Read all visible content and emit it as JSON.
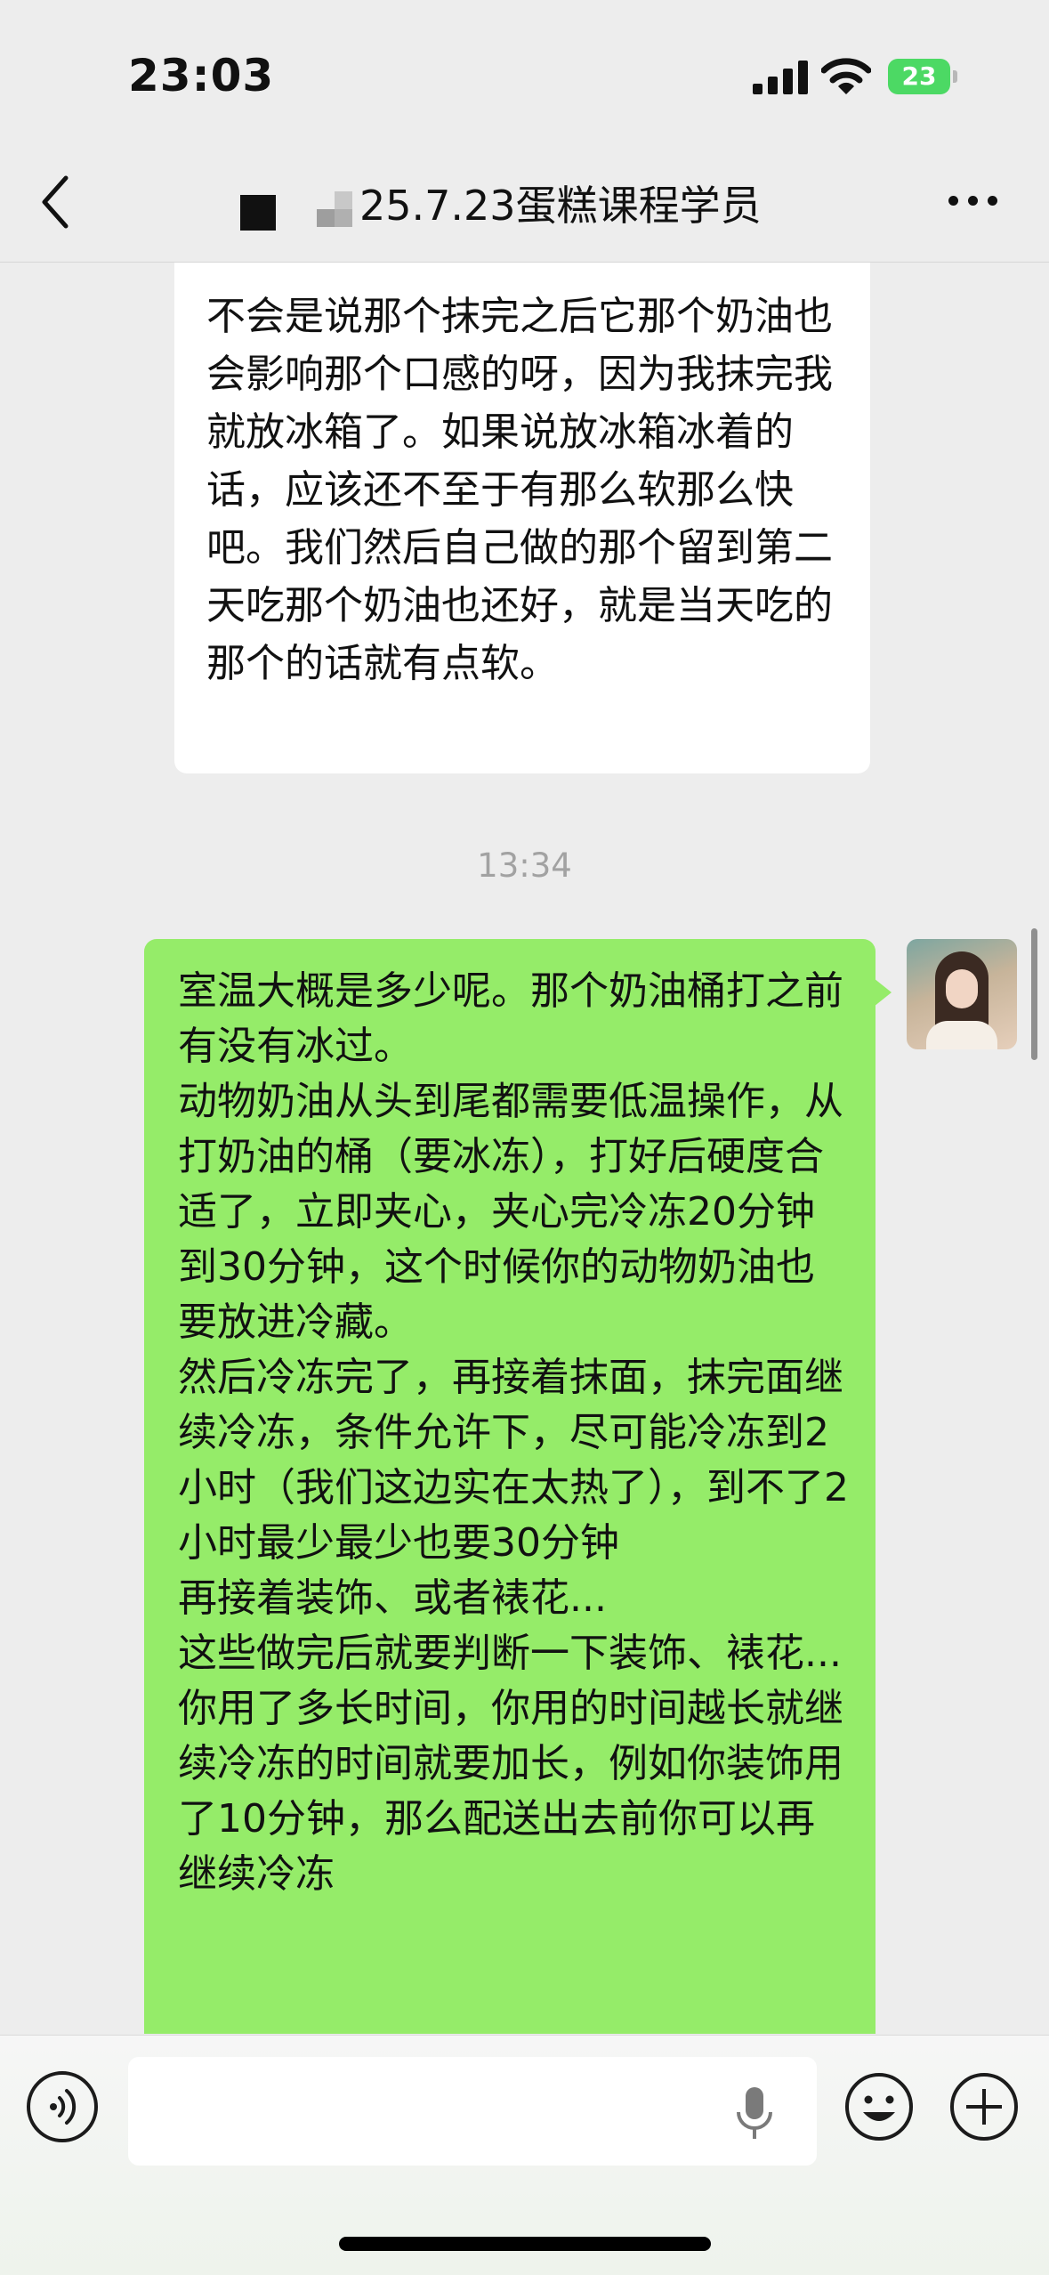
{
  "status_bar": {
    "time": "23:03",
    "battery": "23",
    "icons": [
      "cellular-signal-icon",
      "wifi-icon",
      "battery-charging-icon"
    ]
  },
  "nav": {
    "title": "25.7.23蛋糕课程学员",
    "icons": [
      "back-chevron-icon",
      "more-dots-icon"
    ]
  },
  "messages": {
    "incoming_text": "不会是说那个抹完之后它那个奶油也会影响那个口感的呀，因为我抹完我就放冰箱了。如果说放冰箱冰着的话，应该还不至于有那么软那么快吧。我们然后自己做的那个留到第二天吃那个奶油也还好，就是当天吃的那个的话就有点软。",
    "timestamp": "13:34",
    "outgoing_text": "室温大概是多少呢。那个奶油桶打之前有没有冰过。\n动物奶油从头到尾都需要低温操作，从打奶油的桶（要冰冻），打好后硬度合适了，立即夹心，夹心完冷冻20分钟到30分钟，这个时候你的动物奶油也要放进冷藏。\n然后冷冻完了，再接着抹面，抹完面继续冷冻，条件允许下，尽可能冷冻到2小时（我们这边实在太热了），到不了2小时最少最少也要30分钟\n再接着装饰、或者裱花...\n这些做完后就要判断一下装饰、裱花...你用了多长时间，你用的时间越长就继续冷冻的时间就要加长，例如你装饰用了10分钟，那么配送出去前你可以再继续冷冻"
  },
  "input_bar": {
    "value": "",
    "icons": [
      "voice-icon",
      "microphone-icon",
      "emoji-icon",
      "plus-icon"
    ]
  },
  "colors": {
    "background": "#ededed",
    "incoming_bubble": "#ffffff",
    "outgoing_bubble": "#95ec69",
    "battery_green": "#4cd964",
    "timestamp_gray": "#a2a2a2"
  }
}
